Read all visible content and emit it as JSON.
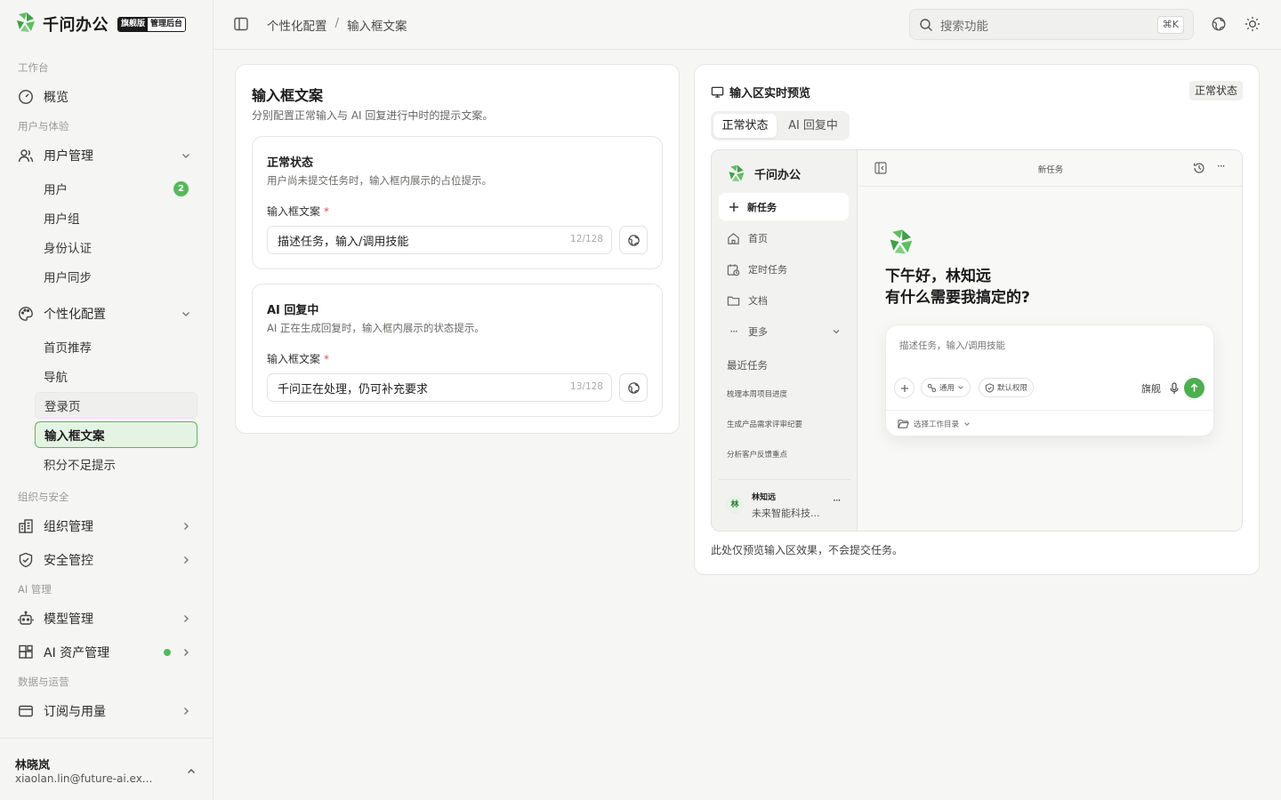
{
  "brand": {
    "name": "千问办公",
    "tag_edition": "旗舰版",
    "tag_admin": "管理后台"
  },
  "sidebar": {
    "sections": [
      "工作台",
      "用户与体验",
      "组织与安全",
      "AI 管理",
      "数据与运营"
    ],
    "overview": "概览",
    "user_mgmt": "用户管理",
    "user_sub": [
      {
        "label": "用户",
        "badge": "2"
      },
      {
        "label": "用户组"
      },
      {
        "label": "身份认证"
      },
      {
        "label": "用户同步"
      }
    ],
    "personal": "个性化配置",
    "personal_sub": [
      "首页推荐",
      "导航",
      "登录页",
      "输入框文案",
      "积分不足提示"
    ],
    "org_mgmt": "组织管理",
    "security": "安全管控",
    "model_mgmt": "模型管理",
    "asset_mgmt": "AI 资产管理",
    "subscription": "订阅与用量",
    "user": {
      "name": "林晓岚",
      "email": "xiaolan.lin@future-ai.ex..."
    }
  },
  "header": {
    "breadcrumb": [
      "个性化配置",
      "输入框文案"
    ],
    "search_placeholder": "搜索功能",
    "shortcut": "⌘K"
  },
  "left_card": {
    "title": "输入框文案",
    "desc": "分别配置正常输入与 AI 回复进行中时的提示文案。",
    "normal": {
      "title": "正常状态",
      "desc": "用户尚未提交任务时，输入框内展示的占位提示。",
      "field_label": "输入框文案",
      "value": "描述任务，输入/调用技能",
      "count": "12/128"
    },
    "replying": {
      "title": "AI 回复中",
      "desc": "AI 正在生成回复时，输入框内展示的状态提示。",
      "field_label": "输入框文案",
      "value": "千问正在处理，仍可补充要求",
      "count": "13/128"
    }
  },
  "preview": {
    "title": "输入区实时预览",
    "status_tag": "正常状态",
    "tabs": [
      "正常状态",
      "AI 回复中"
    ],
    "app_name": "千问办公",
    "new_task": "新任务",
    "nav": [
      "首页",
      "定时任务",
      "文档",
      "更多"
    ],
    "recent_title": "最近任务",
    "recent": [
      "梳理本周项目进度",
      "生成产品需求评审纪要",
      "分析客户反馈重点"
    ],
    "user_avatar": "林",
    "user_name": "林知远",
    "user_org": "未来智能科技...",
    "header_title": "新任务",
    "greeting_1": "下午好，林知远",
    "greeting_2": "有什么需要我搞定的?",
    "placeholder": "描述任务，输入/调用技能",
    "chip_general": "通用",
    "chip_perm": "默认权限",
    "model": "旗舰",
    "workdir": "选择工作目录",
    "footnote": "此处仅预览输入区效果，不会提交任务。"
  }
}
